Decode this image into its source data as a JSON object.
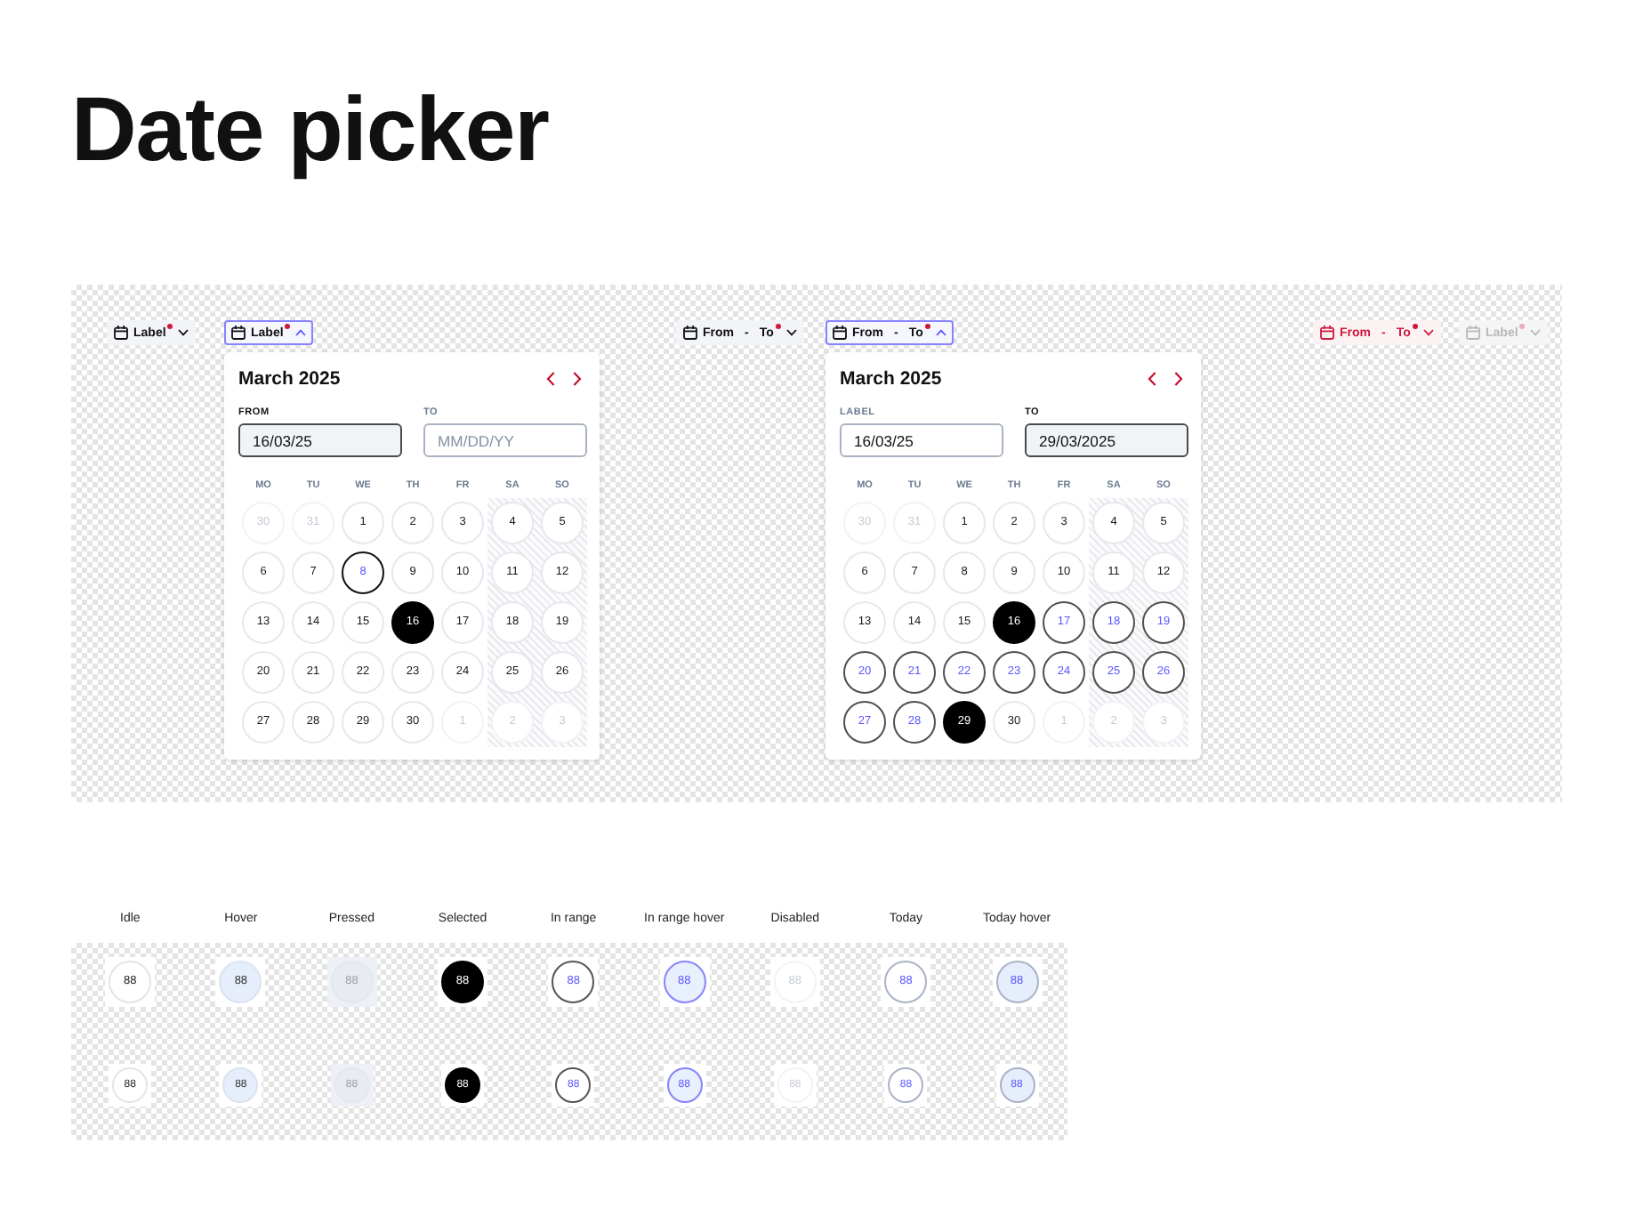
{
  "title": "Date picker",
  "pickers": [
    {
      "trigger": {
        "kind": "single",
        "label": "Label",
        "open": false,
        "error": false,
        "disabled": false,
        "required": true
      }
    },
    {
      "trigger": {
        "kind": "single",
        "label": "Label",
        "open": true,
        "error": false,
        "disabled": false,
        "required": true
      },
      "calendar": {
        "month": "March 2025",
        "fields": [
          {
            "label": "FROM",
            "value": "16/03/25",
            "focused": true
          },
          {
            "label": "TO",
            "placeholder": "MM/DD/YY",
            "focused": false
          }
        ],
        "weekdays": [
          "MO",
          "TU",
          "WE",
          "TH",
          "FR",
          "SA",
          "SO"
        ],
        "days": [
          {
            "text": "30",
            "disabled": true,
            "today": false,
            "selected": false,
            "in_range": false
          },
          {
            "text": "31",
            "disabled": true,
            "today": false,
            "selected": false,
            "in_range": false
          },
          {
            "text": "1",
            "disabled": false,
            "today": false,
            "selected": false,
            "in_range": false
          },
          {
            "text": "2",
            "disabled": false,
            "today": false,
            "selected": false,
            "in_range": false
          },
          {
            "text": "3",
            "disabled": false,
            "today": false,
            "selected": false,
            "in_range": false
          },
          {
            "text": "4",
            "disabled": false,
            "today": false,
            "selected": false,
            "in_range": false
          },
          {
            "text": "5",
            "disabled": false,
            "today": false,
            "selected": false,
            "in_range": false
          },
          {
            "text": "6",
            "disabled": false,
            "today": false,
            "selected": false,
            "in_range": false
          },
          {
            "text": "7",
            "disabled": false,
            "today": false,
            "selected": false,
            "in_range": false
          },
          {
            "text": "8",
            "disabled": false,
            "today": true,
            "selected": false,
            "in_range": false
          },
          {
            "text": "9",
            "disabled": false,
            "today": false,
            "selected": false,
            "in_range": false
          },
          {
            "text": "10",
            "disabled": false,
            "today": false,
            "selected": false,
            "in_range": false
          },
          {
            "text": "11",
            "disabled": false,
            "today": false,
            "selected": false,
            "in_range": false
          },
          {
            "text": "12",
            "disabled": false,
            "today": false,
            "selected": false,
            "in_range": false
          },
          {
            "text": "13",
            "disabled": false,
            "today": false,
            "selected": false,
            "in_range": false
          },
          {
            "text": "14",
            "disabled": false,
            "today": false,
            "selected": false,
            "in_range": false
          },
          {
            "text": "15",
            "disabled": false,
            "today": false,
            "selected": false,
            "in_range": false
          },
          {
            "text": "16",
            "disabled": false,
            "today": false,
            "selected": true,
            "in_range": false
          },
          {
            "text": "17",
            "disabled": false,
            "today": false,
            "selected": false,
            "in_range": false
          },
          {
            "text": "18",
            "disabled": false,
            "today": false,
            "selected": false,
            "in_range": false
          },
          {
            "text": "19",
            "disabled": false,
            "today": false,
            "selected": false,
            "in_range": false
          },
          {
            "text": "20",
            "disabled": false,
            "today": false,
            "selected": false,
            "in_range": false
          },
          {
            "text": "21",
            "disabled": false,
            "today": false,
            "selected": false,
            "in_range": false
          },
          {
            "text": "22",
            "disabled": false,
            "today": false,
            "selected": false,
            "in_range": false
          },
          {
            "text": "23",
            "disabled": false,
            "today": false,
            "selected": false,
            "in_range": false
          },
          {
            "text": "24",
            "disabled": false,
            "today": false,
            "selected": false,
            "in_range": false
          },
          {
            "text": "25",
            "disabled": false,
            "today": false,
            "selected": false,
            "in_range": false
          },
          {
            "text": "26",
            "disabled": false,
            "today": false,
            "selected": false,
            "in_range": false
          },
          {
            "text": "27",
            "disabled": false,
            "today": false,
            "selected": false,
            "in_range": false
          },
          {
            "text": "28",
            "disabled": false,
            "today": false,
            "selected": false,
            "in_range": false
          },
          {
            "text": "29",
            "disabled": false,
            "today": false,
            "selected": false,
            "in_range": false
          },
          {
            "text": "30",
            "disabled": false,
            "today": false,
            "selected": false,
            "in_range": false
          },
          {
            "text": "1",
            "disabled": true,
            "today": false,
            "selected": false,
            "in_range": false
          },
          {
            "text": "2",
            "disabled": true,
            "today": false,
            "selected": false,
            "in_range": false
          },
          {
            "text": "3",
            "disabled": true,
            "today": false,
            "selected": false,
            "in_range": false
          }
        ]
      }
    },
    {
      "trigger": {
        "kind": "range",
        "from": "From",
        "separator": "-",
        "to": "To",
        "open": false,
        "error": false,
        "disabled": false,
        "required": true
      }
    },
    {
      "trigger": {
        "kind": "range",
        "from": "From",
        "separator": "-",
        "to": "To",
        "open": true,
        "error": false,
        "disabled": false,
        "required": true
      },
      "calendar": {
        "month": "March 2025",
        "fields": [
          {
            "label": "LABEL",
            "value": "16/03/25",
            "focused": false
          },
          {
            "label": "TO",
            "value": "29/03/2025",
            "focused": true
          }
        ],
        "weekdays": [
          "MO",
          "TU",
          "WE",
          "TH",
          "FR",
          "SA",
          "SO"
        ],
        "days": [
          {
            "text": "30",
            "disabled": true,
            "today": false,
            "selected": false,
            "in_range": false
          },
          {
            "text": "31",
            "disabled": true,
            "today": false,
            "selected": false,
            "in_range": false
          },
          {
            "text": "1",
            "disabled": false,
            "today": false,
            "selected": false,
            "in_range": false
          },
          {
            "text": "2",
            "disabled": false,
            "today": false,
            "selected": false,
            "in_range": false
          },
          {
            "text": "3",
            "disabled": false,
            "today": false,
            "selected": false,
            "in_range": false
          },
          {
            "text": "4",
            "disabled": false,
            "today": false,
            "selected": false,
            "in_range": false
          },
          {
            "text": "5",
            "disabled": false,
            "today": false,
            "selected": false,
            "in_range": false
          },
          {
            "text": "6",
            "disabled": false,
            "today": false,
            "selected": false,
            "in_range": false
          },
          {
            "text": "7",
            "disabled": false,
            "today": false,
            "selected": false,
            "in_range": false
          },
          {
            "text": "8",
            "disabled": false,
            "today": false,
            "selected": false,
            "in_range": false
          },
          {
            "text": "9",
            "disabled": false,
            "today": false,
            "selected": false,
            "in_range": false
          },
          {
            "text": "10",
            "disabled": false,
            "today": false,
            "selected": false,
            "in_range": false
          },
          {
            "text": "11",
            "disabled": false,
            "today": false,
            "selected": false,
            "in_range": false
          },
          {
            "text": "12",
            "disabled": false,
            "today": false,
            "selected": false,
            "in_range": false
          },
          {
            "text": "13",
            "disabled": false,
            "today": false,
            "selected": false,
            "in_range": false
          },
          {
            "text": "14",
            "disabled": false,
            "today": false,
            "selected": false,
            "in_range": false
          },
          {
            "text": "15",
            "disabled": false,
            "today": false,
            "selected": false,
            "in_range": false
          },
          {
            "text": "16",
            "disabled": false,
            "today": false,
            "selected": true,
            "in_range": false
          },
          {
            "text": "17",
            "disabled": false,
            "today": false,
            "selected": false,
            "in_range": true
          },
          {
            "text": "18",
            "disabled": false,
            "today": false,
            "selected": false,
            "in_range": true
          },
          {
            "text": "19",
            "disabled": false,
            "today": false,
            "selected": false,
            "in_range": true
          },
          {
            "text": "20",
            "disabled": false,
            "today": false,
            "selected": false,
            "in_range": true
          },
          {
            "text": "21",
            "disabled": false,
            "today": false,
            "selected": false,
            "in_range": true
          },
          {
            "text": "22",
            "disabled": false,
            "today": false,
            "selected": false,
            "in_range": true
          },
          {
            "text": "23",
            "disabled": false,
            "today": false,
            "selected": false,
            "in_range": true
          },
          {
            "text": "24",
            "disabled": false,
            "today": false,
            "selected": false,
            "in_range": true
          },
          {
            "text": "25",
            "disabled": false,
            "today": false,
            "selected": false,
            "in_range": true
          },
          {
            "text": "26",
            "disabled": false,
            "today": false,
            "selected": false,
            "in_range": true
          },
          {
            "text": "27",
            "disabled": false,
            "today": false,
            "selected": false,
            "in_range": true
          },
          {
            "text": "28",
            "disabled": false,
            "today": false,
            "selected": false,
            "in_range": true
          },
          {
            "text": "29",
            "disabled": false,
            "today": false,
            "selected": true,
            "in_range": false
          },
          {
            "text": "30",
            "disabled": false,
            "today": false,
            "selected": false,
            "in_range": false
          },
          {
            "text": "1",
            "disabled": true,
            "today": false,
            "selected": false,
            "in_range": false
          },
          {
            "text": "2",
            "disabled": true,
            "today": false,
            "selected": false,
            "in_range": false
          },
          {
            "text": "3",
            "disabled": true,
            "today": false,
            "selected": false,
            "in_range": false
          }
        ]
      }
    },
    {
      "trigger": {
        "kind": "range",
        "from": "From",
        "separator": "-",
        "to": "To",
        "open": false,
        "error": true,
        "disabled": false,
        "required": true
      }
    },
    {
      "trigger": {
        "kind": "single",
        "label": "Label",
        "open": false,
        "error": false,
        "disabled": true,
        "required": true
      }
    }
  ],
  "state_legend": {
    "columns": [
      "Idle",
      "Hover",
      "Pressed",
      "Selected",
      "In range",
      "In range hover",
      "Disabled",
      "Today",
      "Today hover"
    ],
    "rows": [
      {
        "kind": "large",
        "cells": [
          {
            "text": "88",
            "hover": false,
            "pressed": false,
            "selected": false,
            "in_range": false,
            "disabled": false,
            "today": false
          },
          {
            "text": "88",
            "hover": true,
            "pressed": false,
            "selected": false,
            "in_range": false,
            "disabled": false,
            "today": false
          },
          {
            "text": "88",
            "hover": false,
            "pressed": true,
            "selected": false,
            "in_range": false,
            "disabled": false,
            "today": false
          },
          {
            "text": "88",
            "hover": false,
            "pressed": false,
            "selected": true,
            "in_range": false,
            "disabled": false,
            "today": false
          },
          {
            "text": "88",
            "hover": false,
            "pressed": false,
            "selected": false,
            "in_range": true,
            "disabled": false,
            "today": false
          },
          {
            "text": "88",
            "hover": true,
            "pressed": false,
            "selected": false,
            "in_range": true,
            "disabled": false,
            "today": false
          },
          {
            "text": "88",
            "hover": false,
            "pressed": false,
            "selected": false,
            "in_range": false,
            "disabled": true,
            "today": false
          },
          {
            "text": "88",
            "hover": false,
            "pressed": false,
            "selected": false,
            "in_range": false,
            "disabled": false,
            "today": true
          },
          {
            "text": "88",
            "hover": true,
            "pressed": false,
            "selected": false,
            "in_range": false,
            "disabled": false,
            "today": true
          }
        ]
      },
      {
        "kind": "small",
        "cells": [
          {
            "text": "88",
            "hover": false,
            "pressed": false,
            "selected": false,
            "in_range": false,
            "disabled": false,
            "today": false
          },
          {
            "text": "88",
            "hover": true,
            "pressed": false,
            "selected": false,
            "in_range": false,
            "disabled": false,
            "today": false
          },
          {
            "text": "88",
            "hover": false,
            "pressed": true,
            "selected": false,
            "in_range": false,
            "disabled": false,
            "today": false
          },
          {
            "text": "88",
            "hover": false,
            "pressed": false,
            "selected": true,
            "in_range": false,
            "disabled": false,
            "today": false
          },
          {
            "text": "88",
            "hover": false,
            "pressed": false,
            "selected": false,
            "in_range": true,
            "disabled": false,
            "today": false
          },
          {
            "text": "88",
            "hover": true,
            "pressed": false,
            "selected": false,
            "in_range": true,
            "disabled": false,
            "today": false
          },
          {
            "text": "88",
            "hover": false,
            "pressed": false,
            "selected": false,
            "in_range": false,
            "disabled": true,
            "today": false
          },
          {
            "text": "88",
            "hover": false,
            "pressed": false,
            "selected": false,
            "in_range": false,
            "disabled": false,
            "today": true
          },
          {
            "text": "88",
            "hover": true,
            "pressed": false,
            "selected": false,
            "in_range": false,
            "disabled": false,
            "today": true
          }
        ]
      }
    ]
  }
}
